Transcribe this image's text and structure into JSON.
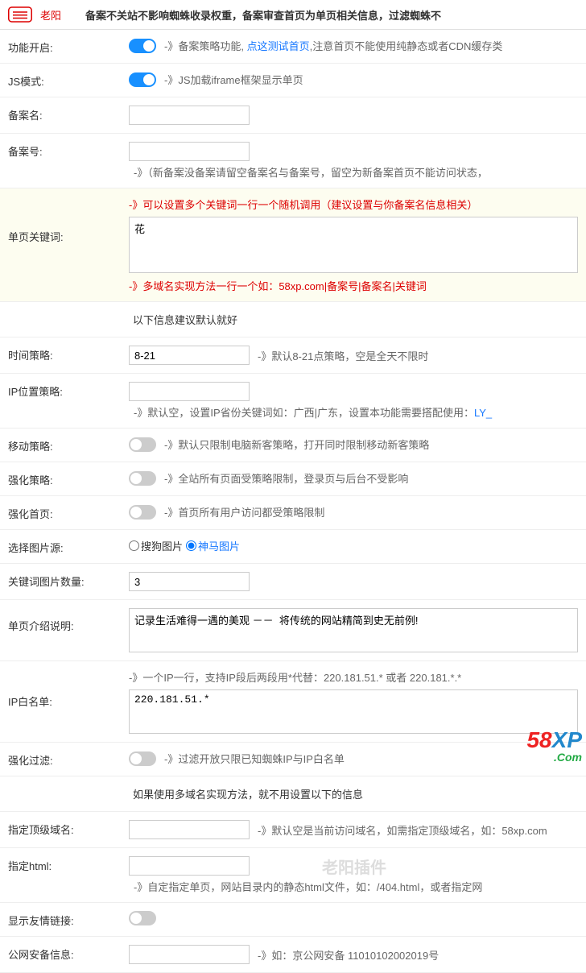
{
  "brand": "老阳",
  "topNotice": "备案不关站不影响蜘蛛收录权重，备案审查首页为单页相关信息，过滤蜘蛛不",
  "sectionNote1": "以下信息建议默认就好",
  "sectionNote2": "如果使用多域名实现方法，就不用设置以下的信息",
  "watermark": "老阳插件",
  "cornerLogo": {
    "p1": "58",
    "p2": "XP",
    "p3": ".Com"
  },
  "rows": {
    "feature": {
      "label": "功能开启:",
      "desc1": "-》备案策略功能,",
      "link": "点这测试首页",
      "desc2": ",注意首页不能使用纯静态或者CDN缓存类"
    },
    "jsMode": {
      "label": "JS模式:",
      "desc": "-》JS加载iframe框架显示单页"
    },
    "recordName": {
      "label": "备案名:",
      "value": ""
    },
    "recordNo": {
      "label": "备案号:",
      "value": "",
      "desc": "-》（新备案没备案请留空备案名与备案号，留空为新备案首页不能访问状态，"
    },
    "keywords": {
      "label": "单页关键词:",
      "hint1": "-》可以设置多个关键词一行一个随机调用（建议设置与你备案名信息相关）",
      "value": "花",
      "hint2": "-》多域名实现方法一行一个如：58xp.com|备案号|备案名|关键词"
    },
    "timePolicy": {
      "label": "时间策略:",
      "value": "8-21",
      "desc": "-》默认8-21点策略，空是全天不限时"
    },
    "ipPolicy": {
      "label": "IP位置策略:",
      "value": "",
      "desc": "-》默认空，设置IP省份关键词如：广西|广东，设置本功能需要搭配使用：",
      "link": "LY_"
    },
    "mobilePolicy": {
      "label": "移动策略:",
      "desc": "-》默认只限制电脑新客策略，打开同时限制移动新客策略"
    },
    "strengthen": {
      "label": "强化策略:",
      "desc": "-》全站所有页面受策略限制，登录页与后台不受影响"
    },
    "strengthenHome": {
      "label": "强化首页:",
      "desc": "-》首页所有用户访问都受策略限制"
    },
    "imgSource": {
      "label": "选择图片源:",
      "opt1": "搜狗图片",
      "opt2": "神马图片"
    },
    "imgCount": {
      "label": "关键词图片数量:",
      "value": "3"
    },
    "pageDesc": {
      "label": "单页介绍说明:",
      "value": "记录生活难得一遇的美观 －－  将传统的网站精简到史无前例!"
    },
    "ipWhite": {
      "label": "IP白名单:",
      "hint": "-》一个IP一行，支持IP段后两段用*代替：220.181.51.* 或者 220.181.*.*",
      "value": "220.181.51.*"
    },
    "strengthenFilter": {
      "label": "强化过滤:",
      "desc": "-》过滤开放只限已知蜘蛛IP与IP白名单"
    },
    "topDomain": {
      "label": "指定顶级域名:",
      "value": "",
      "desc": "-》默认空是当前访问域名，如需指定顶级域名，如：58xp.com"
    },
    "htmlFile": {
      "label": "指定html:",
      "value": "",
      "desc": "-》自定指定单页，网站目录内的静态html文件，如：/404.html，或者指定网"
    },
    "friendLink": {
      "label": "显示友情链接:"
    },
    "police": {
      "label": "公网安备信息:",
      "value": "",
      "desc": "-》如：京公网安备 11010102002019号"
    }
  }
}
